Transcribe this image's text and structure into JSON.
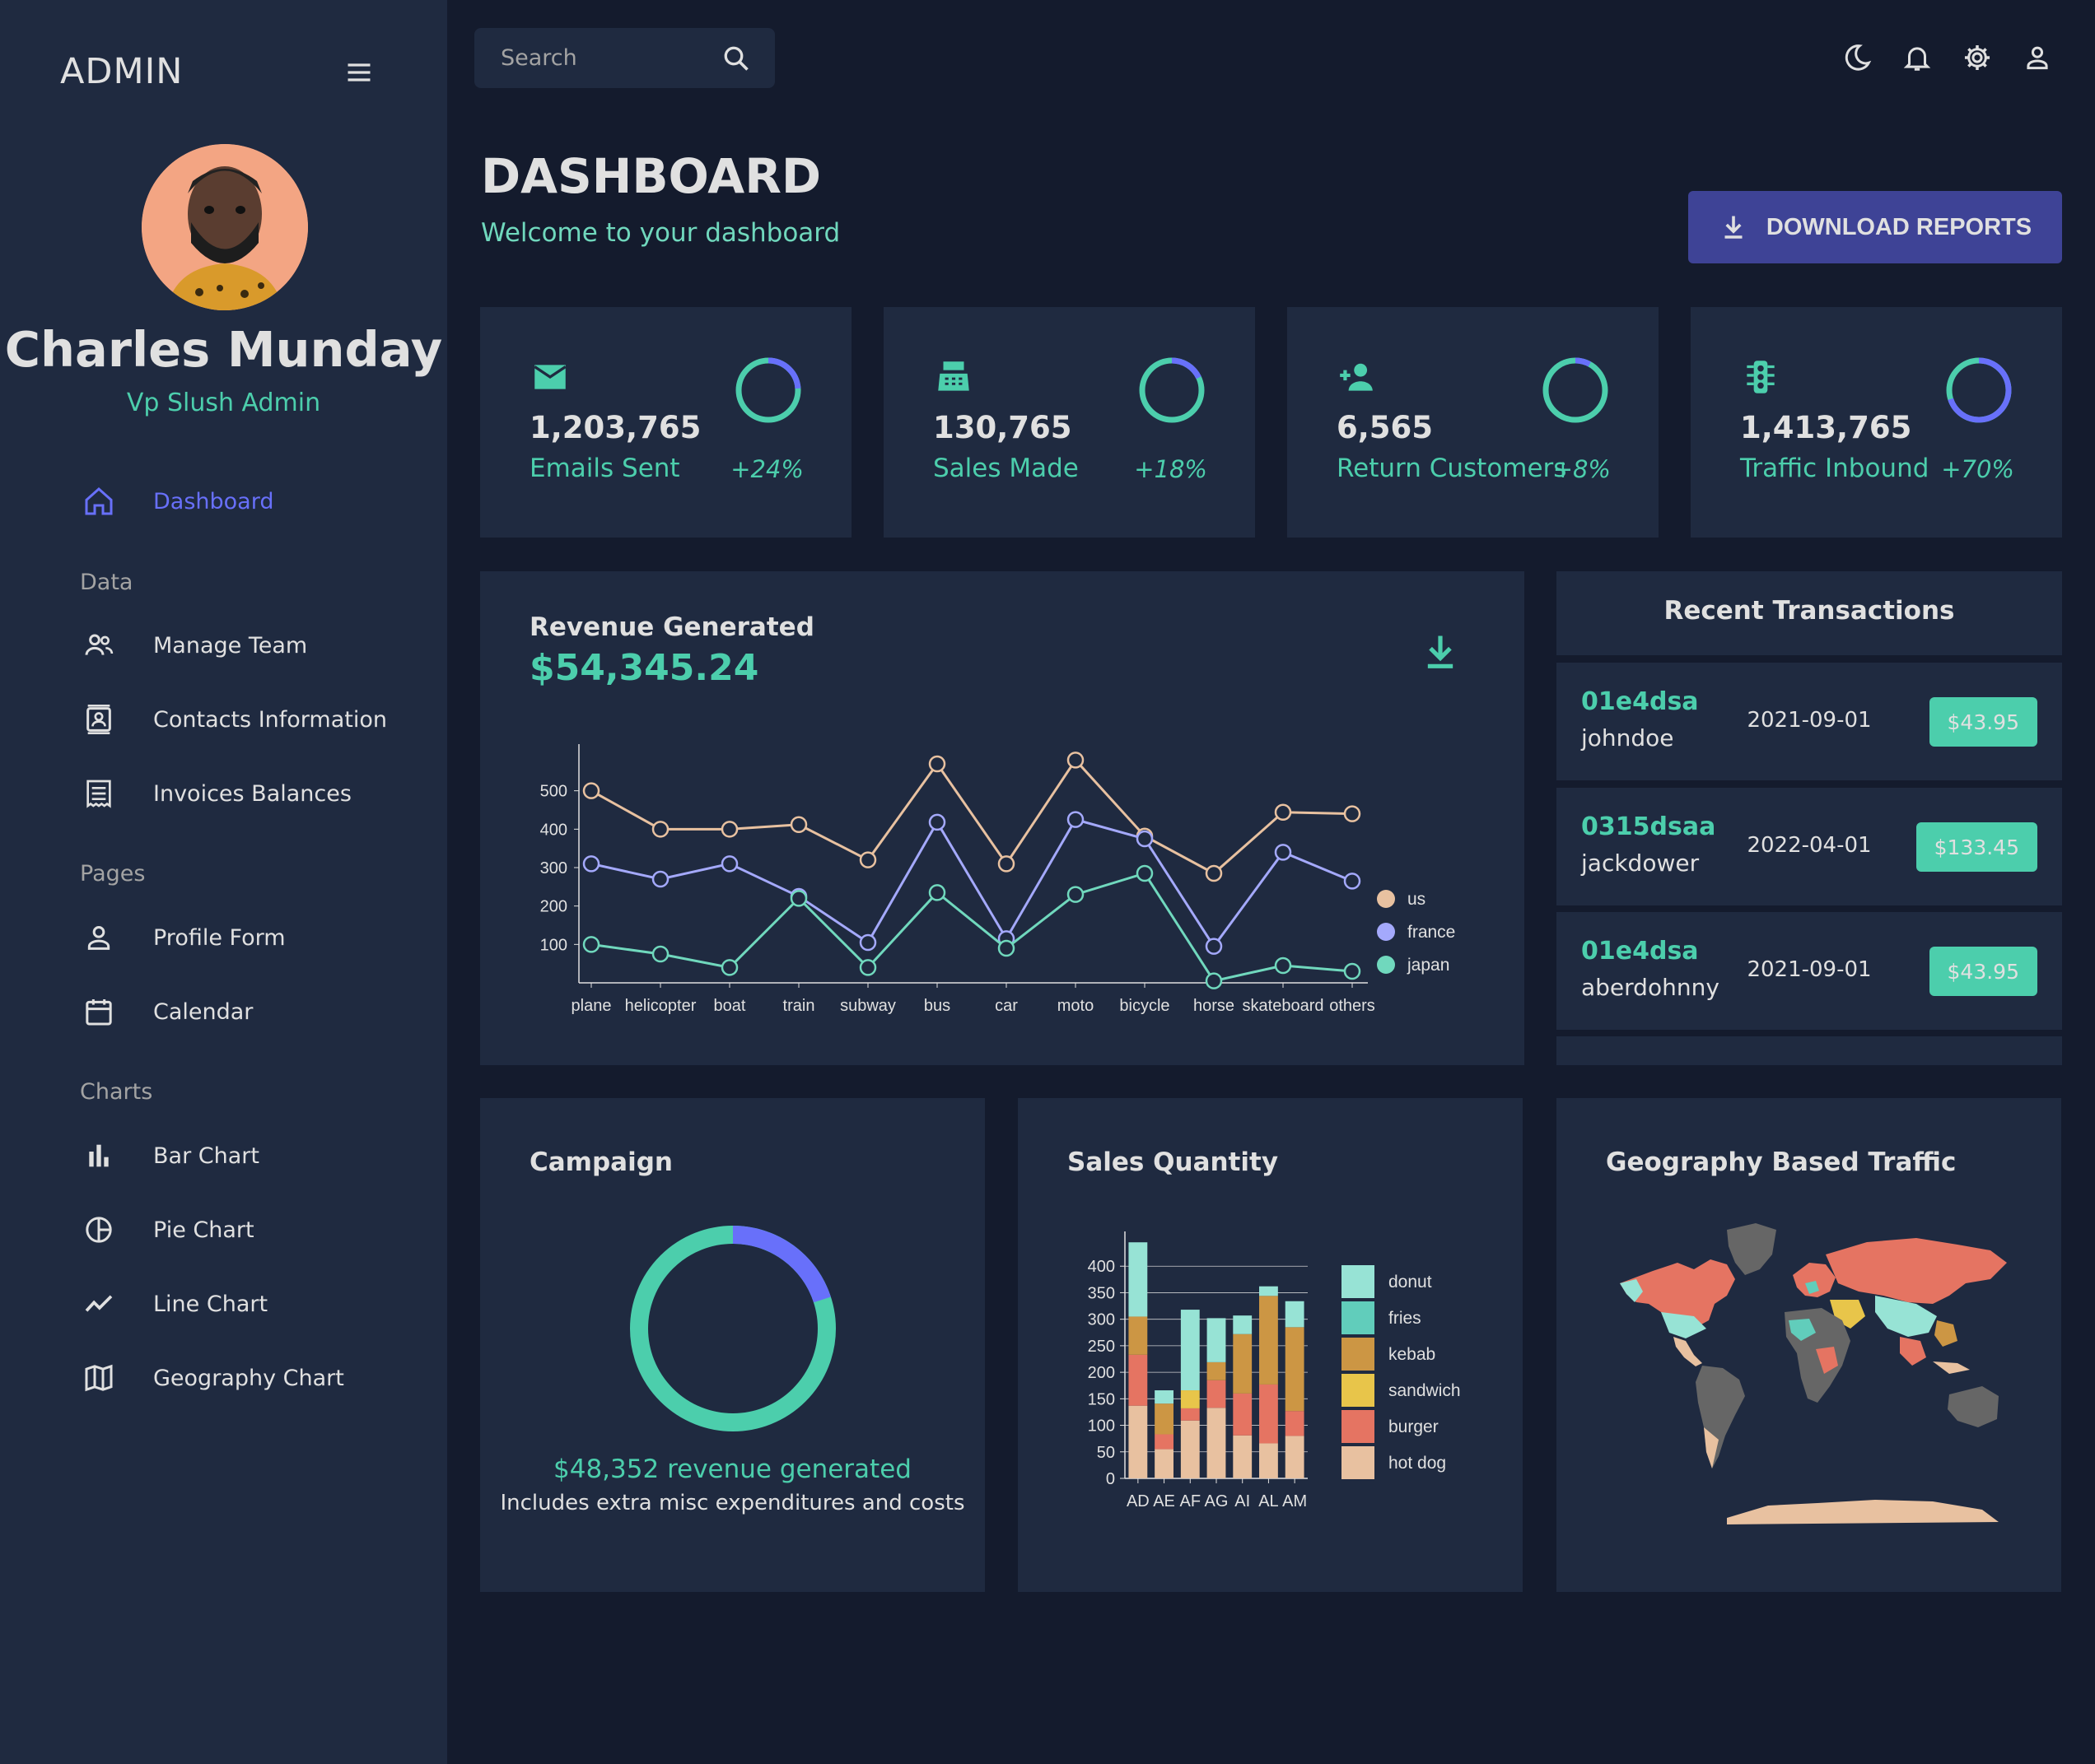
{
  "sidebar": {
    "brand": "ADMIN",
    "user": {
      "name": "Charles Munday",
      "role": "Vp Slush Admin"
    },
    "items": [
      {
        "label": "Dashboard",
        "icon": "home-icon",
        "active": true
      },
      {
        "section": "Data"
      },
      {
        "label": "Manage Team",
        "icon": "people-icon"
      },
      {
        "label": "Contacts Information",
        "icon": "contacts-icon"
      },
      {
        "label": "Invoices Balances",
        "icon": "receipt-icon"
      },
      {
        "section": "Pages"
      },
      {
        "label": "Profile Form",
        "icon": "person-icon"
      },
      {
        "label": "Calendar",
        "icon": "calendar-icon"
      },
      {
        "section": "Charts"
      },
      {
        "label": "Bar Chart",
        "icon": "bar-chart-icon"
      },
      {
        "label": "Pie Chart",
        "icon": "pie-chart-icon"
      },
      {
        "label": "Line Chart",
        "icon": "line-chart-icon"
      },
      {
        "label": "Geography Chart",
        "icon": "map-icon"
      }
    ]
  },
  "topbar": {
    "search_placeholder": "Search",
    "icons": [
      "dark-mode-icon",
      "notifications-icon",
      "settings-icon",
      "person-icon"
    ]
  },
  "header": {
    "title": "DASHBOARD",
    "subtitle": "Welcome to your dashboard",
    "download_label": "DOWNLOAD REPORTS"
  },
  "stats": [
    {
      "value": "1,203,765",
      "label": "Emails Sent",
      "increase": "+24%",
      "progress": 0.24,
      "icon": "email-icon"
    },
    {
      "value": "130,765",
      "label": "Sales Made",
      "increase": "+18%",
      "progress": 0.18,
      "icon": "point-of-sale-icon"
    },
    {
      "value": "6,565",
      "label": "Return Customers",
      "increase": "+8%",
      "progress": 0.08,
      "icon": "person-add-icon"
    },
    {
      "value": "1,413,765",
      "label": "Traffic Inbound",
      "increase": "+70%",
      "progress": 0.7,
      "icon": "traffic-icon"
    }
  ],
  "revenue": {
    "title": "Revenue Generated",
    "amount": "$54,345.24"
  },
  "transactions": {
    "title": "Recent Transactions",
    "rows": [
      {
        "id": "01e4dsa",
        "user": "johndoe",
        "date": "2021-09-01",
        "cost": "$43.95"
      },
      {
        "id": "0315dsaa",
        "user": "jackdower",
        "date": "2022-04-01",
        "cost": "$133.45"
      },
      {
        "id": "01e4dsa",
        "user": "aberdohnny",
        "date": "2021-09-01",
        "cost": "$43.95"
      }
    ]
  },
  "campaign": {
    "title": "Campaign",
    "progress": 0.2,
    "revenue_text": "$48,352 revenue generated",
    "note": "Includes extra misc expenditures and costs"
  },
  "sales_quantity": {
    "title": "Sales Quantity"
  },
  "geography": {
    "title": "Geography Based Traffic"
  },
  "colors": {
    "accent_green": "#4cceac",
    "accent_blue": "#6870fa",
    "button": "#3e4396",
    "panel": "#1f2a40",
    "background": "#141b2d"
  },
  "chart_data": [
    {
      "type": "line",
      "x": [
        "plane",
        "helicopter",
        "boat",
        "train",
        "subway",
        "bus",
        "car",
        "moto",
        "bicycle",
        "horse",
        "skateboard",
        "others"
      ],
      "series": [
        {
          "name": "us",
          "color": "#e8c1a0",
          "values": [
            500,
            400,
            400,
            412,
            320,
            570,
            310,
            580,
            382,
            285,
            444,
            440
          ]
        },
        {
          "name": "france",
          "color": "#a4a9fc",
          "values": [
            310,
            270,
            310,
            225,
            105,
            418,
            115,
            425,
            375,
            95,
            340,
            265
          ]
        },
        {
          "name": "japan",
          "color": "#70d8bd",
          "values": [
            100,
            75,
            40,
            220,
            40,
            235,
            90,
            230,
            285,
            5,
            45,
            30
          ]
        }
      ],
      "yticks": [
        100,
        200,
        300,
        400,
        500
      ],
      "ylim": [
        0,
        600
      ],
      "legend": "right"
    },
    {
      "type": "bar",
      "stacked": true,
      "categories": [
        "AD",
        "AE",
        "AF",
        "AG",
        "AI",
        "AL",
        "AM"
      ],
      "series": [
        {
          "name": "hot dog",
          "color": "#e8c1a0",
          "values": [
            137,
            55,
            109,
            133,
            81,
            66,
            80
          ]
        },
        {
          "name": "burger",
          "color": "#e57462",
          "values": [
            96,
            28,
            23,
            52,
            79,
            111,
            47
          ]
        },
        {
          "name": "sandwich",
          "color": "#e8c54a",
          "values": [
            0,
            0,
            34,
            0,
            0,
            0,
            0
          ]
        },
        {
          "name": "kebab",
          "color": "#cc9644",
          "values": [
            72,
            58,
            0,
            34,
            112,
            167,
            158
          ]
        },
        {
          "name": "fries",
          "color": "#61cdbb",
          "values": [
            0,
            0,
            0,
            0,
            0,
            0,
            0
          ]
        },
        {
          "name": "donut",
          "color": "#97e3d5",
          "values": [
            140,
            25,
            152,
            83,
            35,
            18,
            49
          ]
        }
      ],
      "yticks": [
        0,
        50,
        100,
        150,
        200,
        250,
        300,
        350,
        400
      ],
      "ylim": [
        0,
        450
      ],
      "legend": "right"
    }
  ]
}
